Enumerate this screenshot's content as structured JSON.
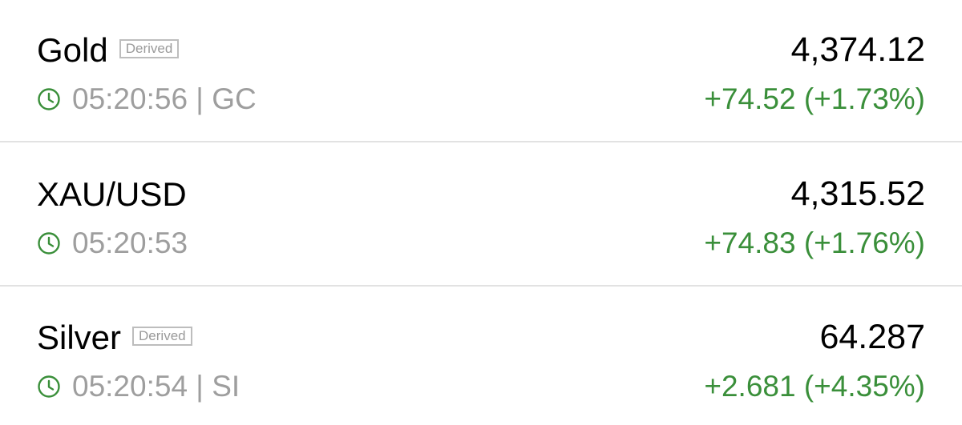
{
  "rows": [
    {
      "name": "Gold",
      "badge": "Derived",
      "time_symbol": "05:20:56 | GC",
      "price": "4,374.12",
      "change": "+74.52 (+1.73%)"
    },
    {
      "name": "XAU/USD",
      "badge": "",
      "time_symbol": "05:20:53",
      "price": "4,315.52",
      "change": "+74.83 (+1.76%)"
    },
    {
      "name": "Silver",
      "badge": "Derived",
      "time_symbol": "05:20:54 | SI",
      "price": "64.287",
      "change": "+2.681 (+4.35%)"
    }
  ],
  "icons": {
    "clock": "clock-icon"
  },
  "colors": {
    "positive": "#3a8f3a",
    "muted": "#9e9e9e",
    "badge_border": "#bdbdbd",
    "divider": "#e2e2e2"
  }
}
